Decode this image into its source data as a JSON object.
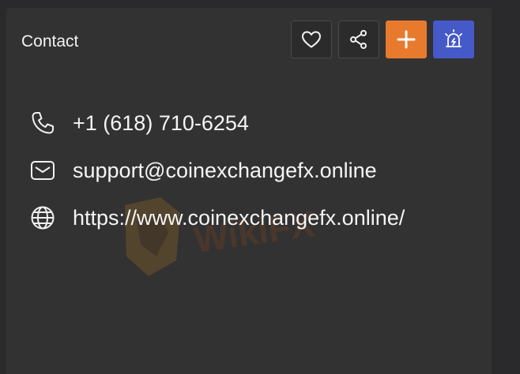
{
  "header": {
    "title": "Contact"
  },
  "actions": [
    {
      "icon": "heart-icon"
    },
    {
      "icon": "share-icon"
    },
    {
      "icon": "plus-icon",
      "color": "#e87a2e"
    },
    {
      "icon": "alarm-icon",
      "color": "#4559c9"
    }
  ],
  "contacts": {
    "phone": {
      "icon": "phone-icon",
      "value": "+1 (618) 710-6254"
    },
    "email": {
      "icon": "mail-icon",
      "value": "support@coinexchangefx.online"
    },
    "website": {
      "icon": "globe-icon",
      "value": "https://www.coinexchangefx.online/"
    }
  },
  "colors": {
    "background": "#2a2a2c",
    "panel": "#323233",
    "accent_orange": "#e87a2e",
    "accent_blue": "#4559c9"
  }
}
